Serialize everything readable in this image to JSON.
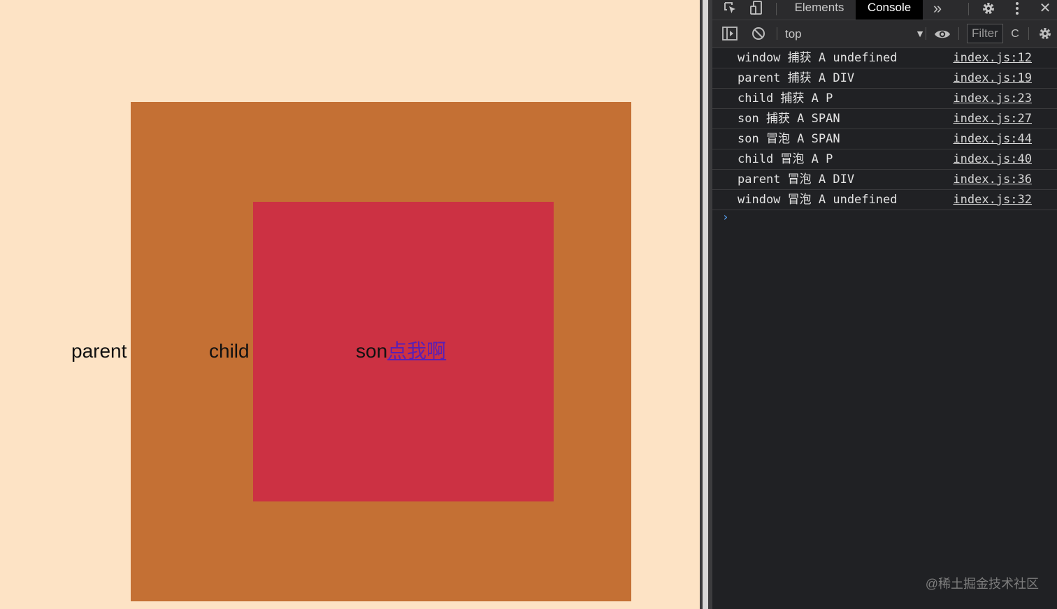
{
  "page": {
    "parent_label": "parent",
    "child_label": "child",
    "son_label": "son",
    "son_link": "点我啊",
    "colors": {
      "background": "#fde3c5",
      "parent": "#c47034",
      "son": "#cc3143",
      "link": "#5a1fb5"
    }
  },
  "devtools": {
    "tabs": [
      {
        "label": "Elements",
        "active": false
      },
      {
        "label": "Console",
        "active": true
      }
    ],
    "icons": {
      "inspect": "inspect-element-icon",
      "device": "device-toggle-icon",
      "more_tabs": "»",
      "settings": "gear-icon",
      "menu": "kebab-menu-icon",
      "close": "✕"
    },
    "toolbar": {
      "context": "top",
      "filter_placeholder": "Filter",
      "truncated_label": "C"
    },
    "console": [
      {
        "message": "window 捕获 A undefined",
        "source": "index.js:12"
      },
      {
        "message": "parent 捕获 A DIV",
        "source": "index.js:19"
      },
      {
        "message": "child 捕获 A P",
        "source": "index.js:23"
      },
      {
        "message": "son 捕获 A SPAN",
        "source": "index.js:27"
      },
      {
        "message": "son 冒泡 A SPAN",
        "source": "index.js:44"
      },
      {
        "message": "child 冒泡 A P",
        "source": "index.js:40"
      },
      {
        "message": "parent 冒泡 A DIV",
        "source": "index.js:36"
      },
      {
        "message": "window 冒泡 A undefined",
        "source": "index.js:32"
      }
    ],
    "prompt": "›"
  },
  "watermark": "@稀土掘金技术社区"
}
